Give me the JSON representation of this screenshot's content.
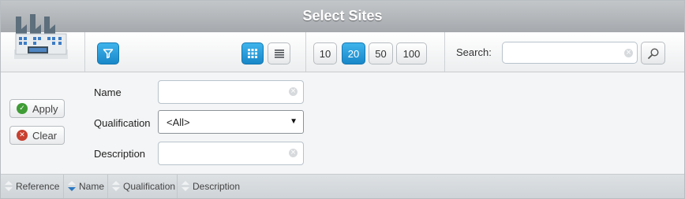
{
  "window": {
    "title": "Select Sites"
  },
  "toolbar": {
    "page_sizes": [
      {
        "label": "10",
        "active": false
      },
      {
        "label": "20",
        "active": true
      },
      {
        "label": "50",
        "active": false
      },
      {
        "label": "100",
        "active": false
      }
    ],
    "search": {
      "label": "Search:",
      "value": "",
      "placeholder": ""
    }
  },
  "filter_panel": {
    "apply_label": "Apply",
    "clear_label": "Clear",
    "fields": {
      "name": {
        "label": "Name",
        "value": ""
      },
      "qualification": {
        "label": "Qualification",
        "value": "<All>"
      },
      "description": {
        "label": "Description",
        "value": ""
      }
    }
  },
  "grid": {
    "columns": [
      {
        "label": "Reference",
        "sort": "none"
      },
      {
        "label": "Name",
        "sort": "desc"
      },
      {
        "label": "Qualification",
        "sort": "none"
      },
      {
        "label": "Description",
        "sort": "none"
      }
    ]
  },
  "colors": {
    "accent": "#1f92d6",
    "apply_icon": "#3f9c35",
    "clear_icon": "#c8402f"
  },
  "icons": [
    "factory-logo-icon",
    "filter-icon",
    "grid-view-icon",
    "list-view-icon",
    "clear-x-icon",
    "search-icon",
    "checkmark-icon",
    "close-icon",
    "sort-icon"
  ]
}
